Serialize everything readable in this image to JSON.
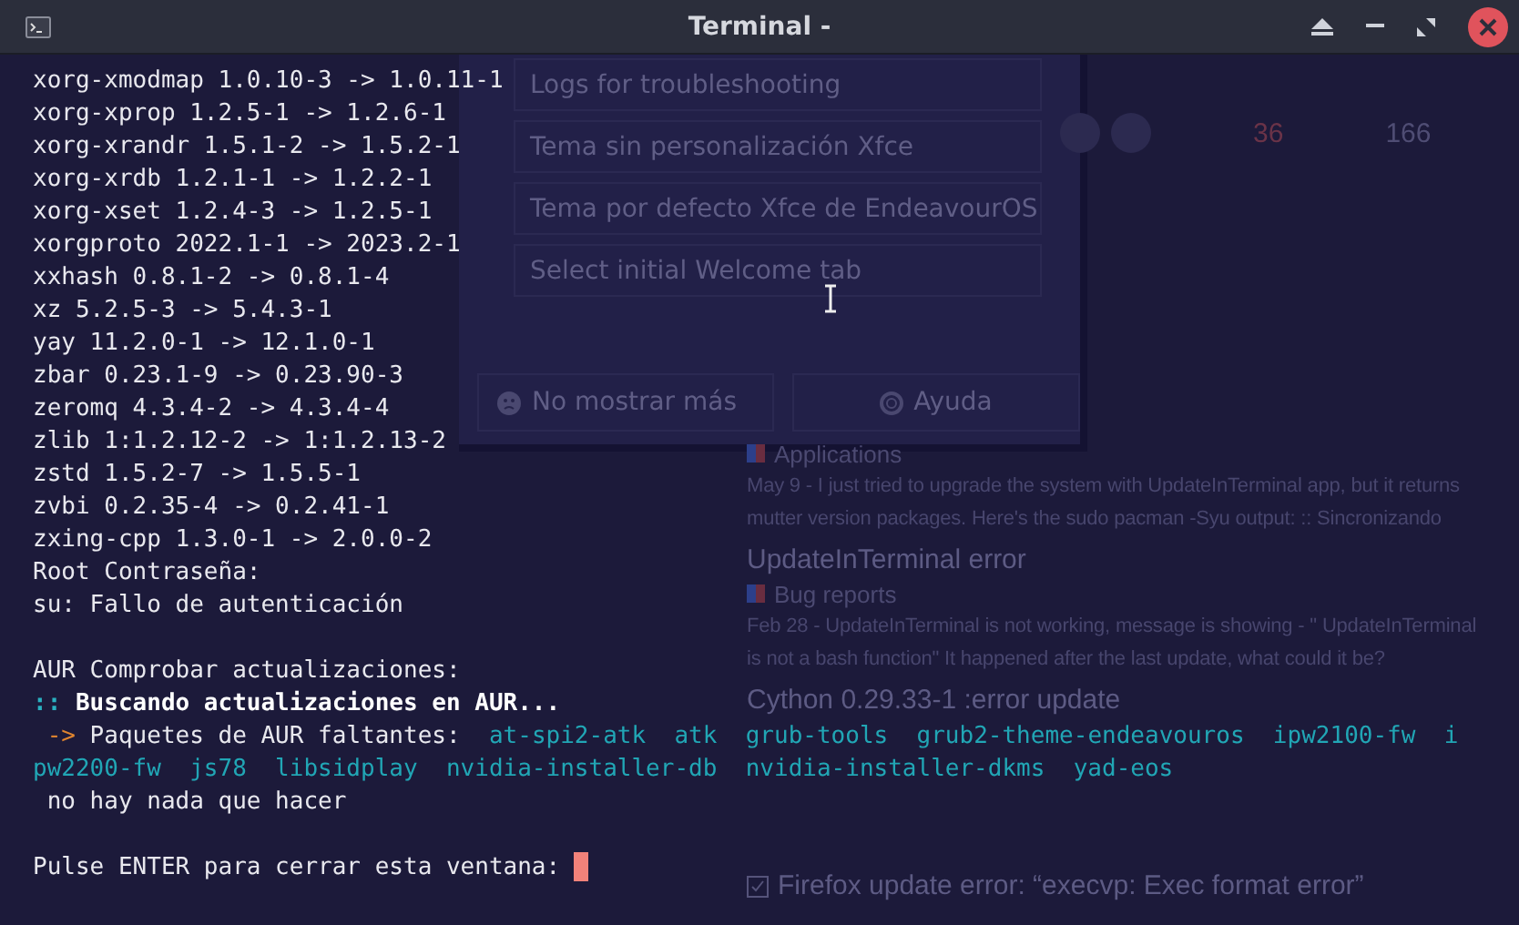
{
  "window": {
    "title": "Terminal -"
  },
  "terminal": {
    "lines": [
      {
        "kind": "text",
        "segments": [
          {
            "kind": "plain",
            "text": "xorg-xmodmap 1.0.10-3 -> 1.0.11-1"
          }
        ]
      },
      {
        "kind": "text",
        "segments": [
          {
            "kind": "plain",
            "text": "xorg-xprop 1.2.5-1 -> 1.2.6-1"
          }
        ]
      },
      {
        "kind": "text",
        "segments": [
          {
            "kind": "plain",
            "text": "xorg-xrandr 1.5.1-2 -> 1.5.2-1"
          }
        ]
      },
      {
        "kind": "text",
        "segments": [
          {
            "kind": "plain",
            "text": "xorg-xrdb 1.2.1-1 -> 1.2.2-1"
          }
        ]
      },
      {
        "kind": "text",
        "segments": [
          {
            "kind": "plain",
            "text": "xorg-xset 1.2.4-3 -> 1.2.5-1"
          }
        ]
      },
      {
        "kind": "text",
        "segments": [
          {
            "kind": "plain",
            "text": "xorgproto 2022.1-1 -> 2023.2-1"
          }
        ]
      },
      {
        "kind": "text",
        "segments": [
          {
            "kind": "plain",
            "text": "xxhash 0.8.1-2 -> 0.8.1-4"
          }
        ]
      },
      {
        "kind": "text",
        "segments": [
          {
            "kind": "plain",
            "text": "xz 5.2.5-3 -> 5.4.3-1"
          }
        ]
      },
      {
        "kind": "text",
        "segments": [
          {
            "kind": "plain",
            "text": "yay 11.2.0-1 -> 12.1.0-1"
          }
        ]
      },
      {
        "kind": "text",
        "segments": [
          {
            "kind": "plain",
            "text": "zbar 0.23.1-9 -> 0.23.90-3"
          }
        ]
      },
      {
        "kind": "text",
        "segments": [
          {
            "kind": "plain",
            "text": "zeromq 4.3.4-2 -> 4.3.4-4"
          }
        ]
      },
      {
        "kind": "text",
        "segments": [
          {
            "kind": "plain",
            "text": "zlib 1:1.2.12-2 -> 1:1.2.13-2"
          }
        ]
      },
      {
        "kind": "text",
        "segments": [
          {
            "kind": "plain",
            "text": "zstd 1.5.2-7 -> 1.5.5-1"
          }
        ]
      },
      {
        "kind": "text",
        "segments": [
          {
            "kind": "plain",
            "text": "zvbi 0.2.35-4 -> 0.2.41-1"
          }
        ]
      },
      {
        "kind": "text",
        "segments": [
          {
            "kind": "plain",
            "text": "zxing-cpp 1.3.0-1 -> 2.0.0-2"
          }
        ]
      },
      {
        "kind": "text",
        "segments": [
          {
            "kind": "plain",
            "text": "Root Contraseña:"
          }
        ]
      },
      {
        "kind": "text",
        "segments": [
          {
            "kind": "plain",
            "text": "su: Fallo de autenticación"
          }
        ]
      },
      {
        "kind": "blank"
      },
      {
        "kind": "text",
        "segments": [
          {
            "kind": "plain",
            "text": "AUR Comprobar actualizaciones:"
          }
        ]
      },
      {
        "kind": "text",
        "segments": [
          {
            "kind": "accent",
            "text": "::"
          },
          {
            "kind": "bold",
            "text": " Buscando actualizaciones en AUR..."
          }
        ]
      },
      {
        "kind": "text",
        "segments": [
          {
            "kind": "arrow",
            "text": " ->"
          },
          {
            "kind": "plain",
            "text": " Paquetes de AUR faltantes:  "
          },
          {
            "kind": "package",
            "text": "at-spi2-atk  atk  grub-tools  grub2-theme-endeavouros  ipw2100-fw  i"
          }
        ]
      },
      {
        "kind": "text",
        "segments": [
          {
            "kind": "package",
            "text": "pw2200-fw  js78  libsidplay  nvidia-installer-db  nvidia-installer-dkms  yad-eos"
          }
        ]
      },
      {
        "kind": "text",
        "segments": [
          {
            "kind": "plain",
            "text": " no hay nada que hacer"
          }
        ]
      },
      {
        "kind": "blank"
      },
      {
        "kind": "prompt",
        "segments": [
          {
            "kind": "plain",
            "text": "Pulse ENTER para cerrar esta ventana: "
          }
        ]
      }
    ]
  },
  "background_dialog": {
    "items": [
      "Logs for troubleshooting",
      "Tema sin personalización Xfce",
      "Tema por defecto Xfce de EndeavourOS",
      "Select initial Welcome tab"
    ],
    "buttons": [
      {
        "kind": "sad",
        "label": "No mostrar más"
      },
      {
        "kind": "help",
        "label": "Ayuda"
      }
    ]
  },
  "background_stats": [
    {
      "text": "36",
      "kind": "highlight"
    },
    {
      "text": "166",
      "kind": "plain"
    }
  ],
  "background_forum": [
    {
      "kind": "category",
      "text": "Applications"
    },
    {
      "kind": "excerpt",
      "text": "May 9 - I just tried to upgrade the system with UpdateInTerminal app, but it returns"
    },
    {
      "kind": "excerpt",
      "text": "mutter version packages. Here's the sudo pacman -Syu output: :: Sincronizando"
    },
    {
      "kind": "heading",
      "text": "UpdateInTerminal error"
    },
    {
      "kind": "category",
      "text": "Bug reports"
    },
    {
      "kind": "excerpt",
      "text": "Feb 28 - UpdateInTerminal is not working, message is showing - \" UpdateInTerminal"
    },
    {
      "kind": "excerpt",
      "text": "is not a bash function\" It happened after the last update, what could it be?"
    },
    {
      "kind": "heading",
      "text": "Cython 0.29.33-1 :error update"
    },
    {
      "kind": "solved",
      "text": "Firefox update error: “execvp: Exec format error”"
    }
  ]
}
